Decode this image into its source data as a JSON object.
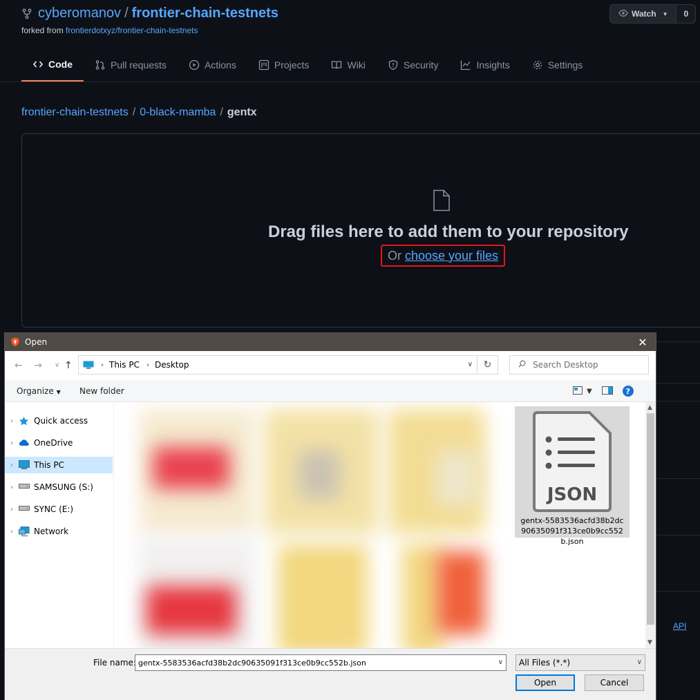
{
  "repo": {
    "owner": "cyberomanov",
    "separator": "/",
    "name": "frontier-chain-testnets",
    "forked_prefix": "forked from",
    "forked_from": "frontierdotxyz/frontier-chain-testnets"
  },
  "watch": {
    "label": "Watch",
    "count": "0"
  },
  "tabs": [
    {
      "label": "Code",
      "icon": "code-icon"
    },
    {
      "label": "Pull requests",
      "icon": "pull-request-icon"
    },
    {
      "label": "Actions",
      "icon": "play-icon"
    },
    {
      "label": "Projects",
      "icon": "project-icon"
    },
    {
      "label": "Wiki",
      "icon": "book-icon"
    },
    {
      "label": "Security",
      "icon": "shield-icon"
    },
    {
      "label": "Insights",
      "icon": "graph-icon"
    },
    {
      "label": "Settings",
      "icon": "gear-icon"
    }
  ],
  "breadcrumb": {
    "root": "frontier-chain-testnets",
    "folder": "0-black-mamba",
    "current": "gentx",
    "separator": "/"
  },
  "dropzone": {
    "title": "Drag files here to add them to your repository",
    "or": "Or",
    "choose": "choose your files"
  },
  "footer": {
    "api": "API"
  },
  "dialog": {
    "title": "Open",
    "close": "✕",
    "address": {
      "root": "This PC",
      "folder": "Desktop"
    },
    "search_placeholder": "Search Desktop",
    "organize": "Organize",
    "new_folder": "New folder",
    "help": "?",
    "nav": [
      {
        "label": "Quick access",
        "icon": "star-icon"
      },
      {
        "label": "OneDrive",
        "icon": "cloud-icon"
      },
      {
        "label": "This PC",
        "icon": "computer-icon",
        "selected": true
      },
      {
        "label": "SAMSUNG (S:)",
        "icon": "drive-icon"
      },
      {
        "label": "SYNC (E:)",
        "icon": "drive-icon"
      },
      {
        "label": "Network",
        "icon": "network-icon"
      }
    ],
    "file": {
      "icon_text": "JSON",
      "name": "gentx-5583536acfd38b2dc90635091f313ce0b9cc552b.json"
    },
    "file_name_label": "File name:",
    "file_name_value": "gentx-5583536acfd38b2dc90635091f313ce0b9cc552b.json",
    "file_type": "All Files (*.*)",
    "open": "Open",
    "cancel": "Cancel"
  },
  "colors": {
    "bg": "#0d1117",
    "link": "#58a6ff",
    "highlight": "#e5141c",
    "selection": "#cce8ff",
    "titlebar": "#4f4a46"
  }
}
